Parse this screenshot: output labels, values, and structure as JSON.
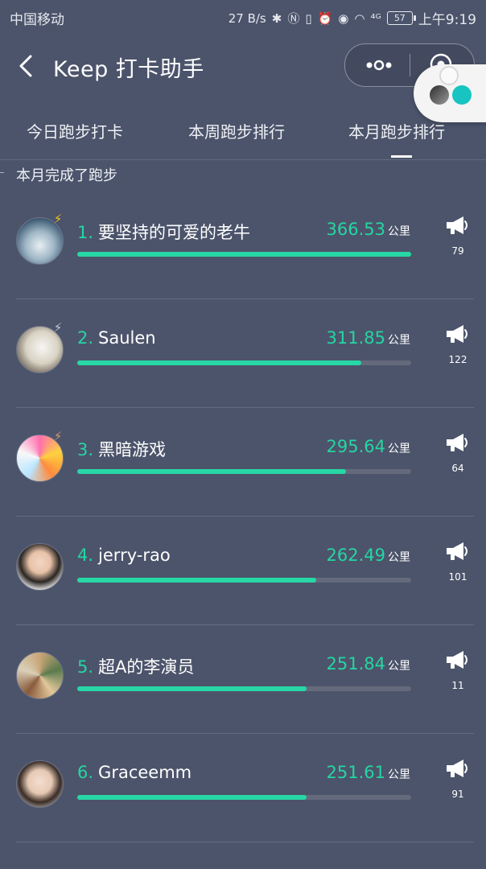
{
  "status_bar": {
    "carrier": "中国移动",
    "speed": "27 B/s",
    "network": "⁴ᴳ",
    "battery": "57",
    "time": "上午9:19"
  },
  "nav": {
    "title": "Keep 打卡助手",
    "back_icon": "chevron-left-icon",
    "more_icon": "more-dots-icon",
    "close_icon": "target-icon"
  },
  "tabs": [
    {
      "label": "今日跑步打卡",
      "active": false
    },
    {
      "label": "本周跑步排行",
      "active": false
    },
    {
      "label": "本月跑步排行",
      "active": true
    }
  ],
  "section_label": "本月完成了跑步",
  "unit_label": "公里",
  "colors": {
    "background": "#4c546b",
    "accent": "#25d6a2",
    "track": "#646a7c"
  },
  "ranking": [
    {
      "rank": "1.",
      "name": "要坚持的可爱的老牛",
      "distance": "366.53",
      "progress": 1.0,
      "cheers": "79",
      "medal": "gold"
    },
    {
      "rank": "2.",
      "name": "Saulen",
      "distance": "311.85",
      "progress": 0.85,
      "cheers": "122",
      "medal": "silver"
    },
    {
      "rank": "3.",
      "name": "黑暗游戏",
      "distance": "295.64",
      "progress": 0.806,
      "cheers": "64",
      "medal": "bronze"
    },
    {
      "rank": "4.",
      "name": "jerry-rao",
      "distance": "262.49",
      "progress": 0.716,
      "cheers": "101",
      "medal": ""
    },
    {
      "rank": "5.",
      "name": "超A的李演员",
      "distance": "251.84",
      "progress": 0.687,
      "cheers": "11",
      "medal": ""
    },
    {
      "rank": "6.",
      "name": "Graceemm",
      "distance": "251.61",
      "progress": 0.687,
      "cheers": "91",
      "medal": ""
    }
  ]
}
